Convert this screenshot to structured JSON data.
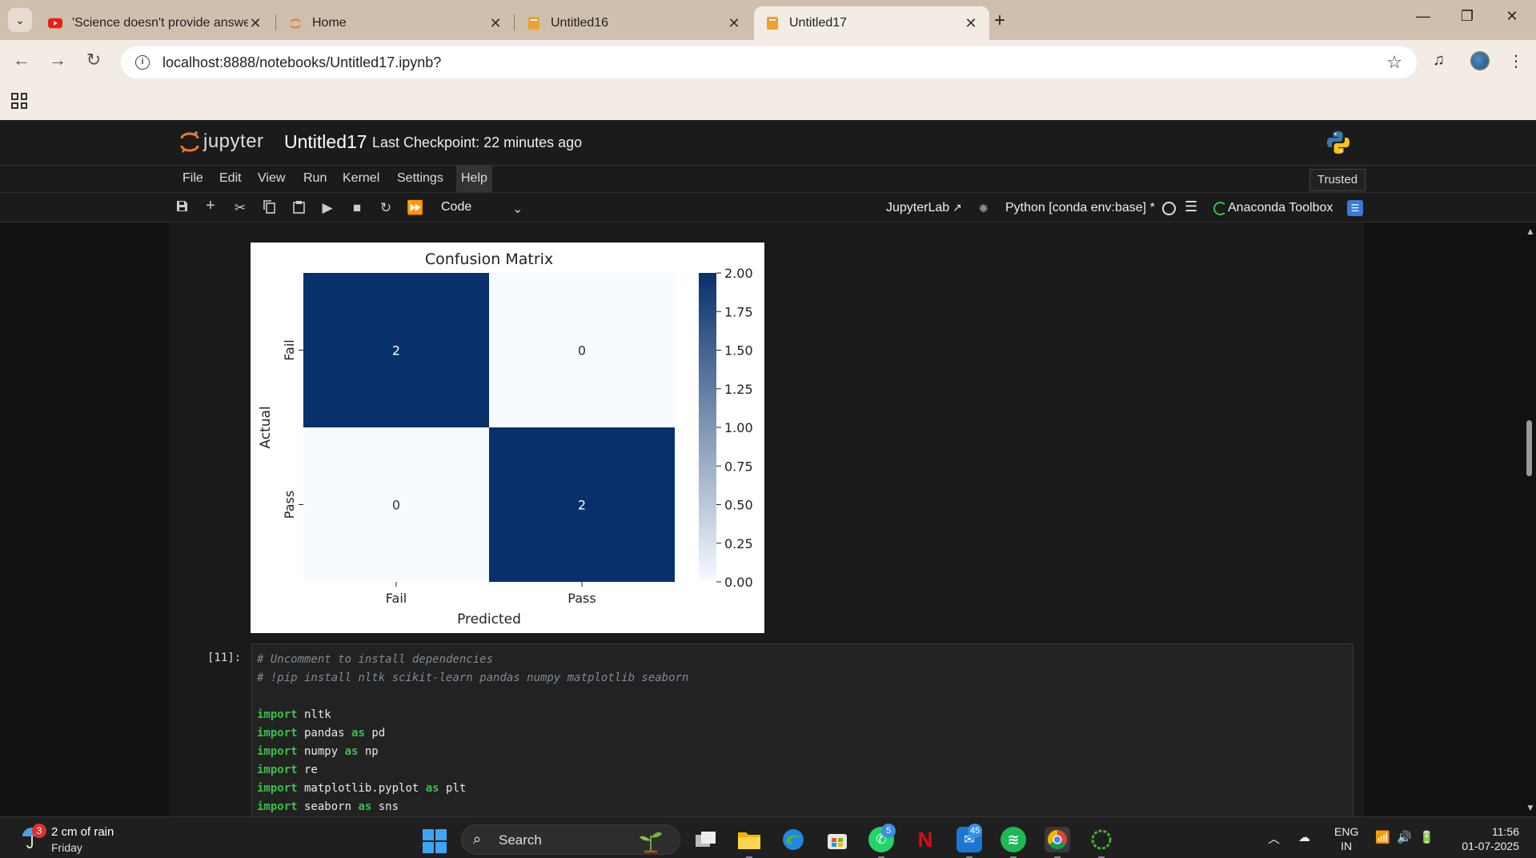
{
  "browser": {
    "tabs": [
      {
        "title": "'Science doesn't provide answe",
        "favicon": "youtube-icon"
      },
      {
        "title": "Home",
        "favicon": "jupyter-icon"
      },
      {
        "title": "Untitled16",
        "favicon": "notebook-icon"
      },
      {
        "title": "Untitled17",
        "favicon": "notebook-icon",
        "active": true
      }
    ],
    "url": "localhost:8888/notebooks/Untitled17.ipynb?"
  },
  "jupyter": {
    "logo_text": "jupyter",
    "notebook_title": "Untitled17",
    "checkpoint": "Last Checkpoint: 22 minutes ago",
    "menu": [
      "File",
      "Edit",
      "View",
      "Run",
      "Kernel",
      "Settings",
      "Help"
    ],
    "trusted": "Trusted",
    "toolbar": {
      "cell_type": "Code",
      "jupyterlab": "JupyterLab",
      "kernel": "Python [conda env:base] *",
      "anaconda": "Anaconda Toolbox"
    }
  },
  "chart_data": {
    "type": "heatmap",
    "title": "Confusion Matrix",
    "xlabel": "Predicted",
    "ylabel": "Actual",
    "x_categories": [
      "Fail",
      "Pass"
    ],
    "y_categories": [
      "Fail",
      "Pass"
    ],
    "values": [
      [
        2,
        0
      ],
      [
        0,
        2
      ]
    ],
    "colorbar": {
      "min": 0,
      "max": 2,
      "ticks": [
        "2.00",
        "1.75",
        "1.50",
        "1.25",
        "1.00",
        "0.75",
        "0.50",
        "0.25",
        "0.00"
      ]
    },
    "colormap": {
      "low": "#f7fbff",
      "high": "#08306b"
    }
  },
  "cell": {
    "prompt": "[11]:",
    "lines": [
      {
        "type": "comment",
        "text": "# Uncomment to install dependencies"
      },
      {
        "type": "comment",
        "text": "# !pip install nltk scikit-learn pandas numpy matplotlib seaborn"
      },
      {
        "type": "blank",
        "text": ""
      },
      {
        "type": "import",
        "module": "nltk",
        "alias": ""
      },
      {
        "type": "import",
        "module": "pandas",
        "alias": "pd"
      },
      {
        "type": "import",
        "module": "numpy",
        "alias": "np"
      },
      {
        "type": "import",
        "module": "re",
        "alias": ""
      },
      {
        "type": "import",
        "module": "matplotlib.pyplot",
        "alias": "plt"
      },
      {
        "type": "import",
        "module": "seaborn",
        "alias": "sns"
      }
    ]
  },
  "taskbar": {
    "weather_badge": "3",
    "weather_text": "2 cm of rain",
    "weather_day": "Friday",
    "search_label": "Search",
    "whatsapp_badge": "5",
    "mail_badge": "45",
    "lang_line1": "ENG",
    "lang_line2": "IN",
    "time": "11:56",
    "date": "01-07-2025"
  }
}
